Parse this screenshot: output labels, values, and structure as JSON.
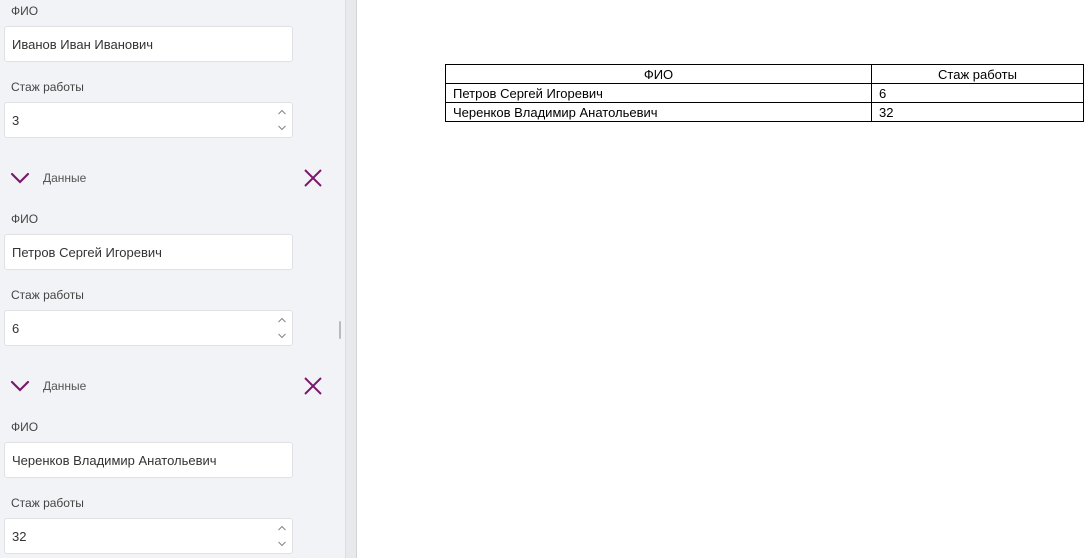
{
  "colors": {
    "accent": "#7a1a6e",
    "panel_bg": "#f2f3f6"
  },
  "sidebar": {
    "partial_record": {
      "name_label": "ФИО",
      "name_value": "Иванов Иван Иванович",
      "experience_label": "Стаж работы",
      "experience_value": "3"
    },
    "records": [
      {
        "section_title": "Данные",
        "name_label": "ФИО",
        "name_value": "Петров Сергей Игоревич",
        "experience_label": "Стаж работы",
        "experience_value": "6"
      },
      {
        "section_title": "Данные",
        "name_label": "ФИО",
        "name_value": "Черенков Владимир Анатольевич",
        "experience_label": "Стаж работы",
        "experience_value": "32"
      }
    ]
  },
  "preview_table": {
    "headers": [
      "ФИО",
      "Стаж работы"
    ],
    "rows": [
      [
        "Петров Сергей Игоревич",
        "6"
      ],
      [
        "Черенков Владимир Анатольевич",
        "32"
      ]
    ]
  }
}
